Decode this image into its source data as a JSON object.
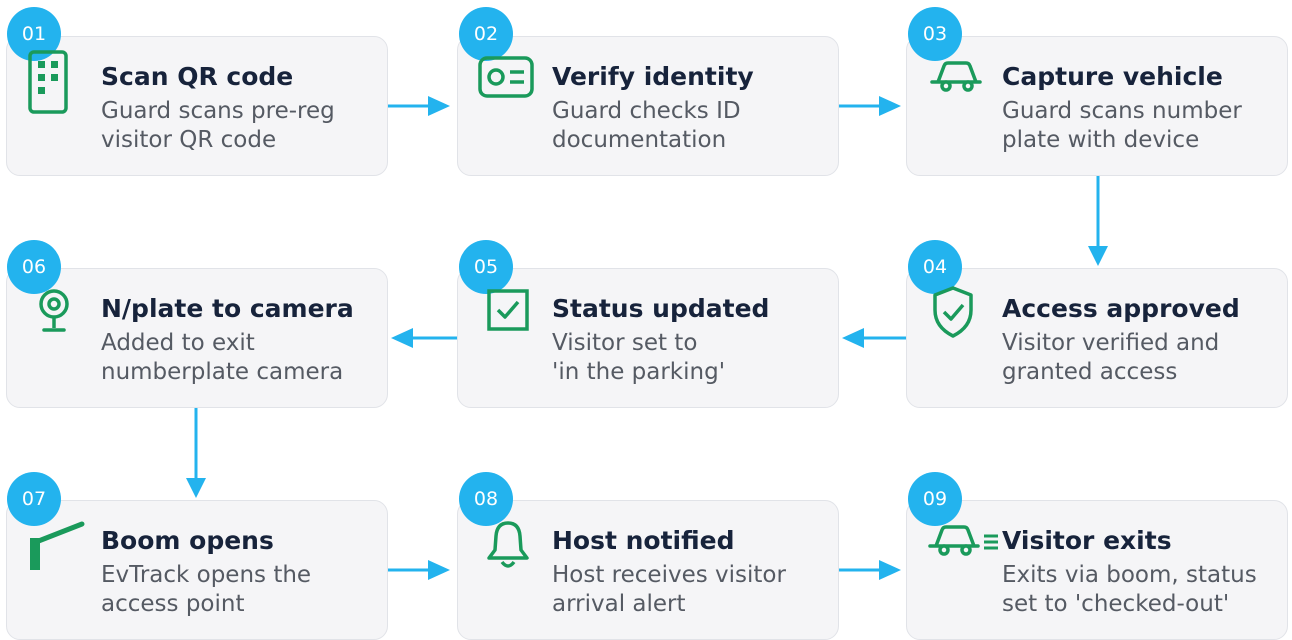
{
  "colors": {
    "accent": "#23b3ee",
    "icon_green": "#1a9a5b",
    "card_bg": "#f5f5f7",
    "card_border": "#e1e3e8",
    "title": "#17233b",
    "text": "#555a63"
  },
  "steps": [
    {
      "num": "01",
      "icon": "qr-code-icon",
      "title": "Scan QR code",
      "desc": [
        "Guard scans pre-reg",
        "visitor QR code"
      ]
    },
    {
      "num": "02",
      "icon": "id-card-icon",
      "title": "Verify identity",
      "desc": [
        "Guard checks ID",
        "documentation"
      ]
    },
    {
      "num": "03",
      "icon": "car-icon",
      "title": "Capture vehicle",
      "desc": [
        "Guard scans number",
        "plate with device"
      ]
    },
    {
      "num": "04",
      "icon": "shield-check-icon",
      "title": "Access approved",
      "desc": [
        "Visitor verified and",
        "granted access"
      ]
    },
    {
      "num": "05",
      "icon": "checkbox-icon",
      "title": "Status updated",
      "desc": [
        "Visitor set to",
        "'in the parking'"
      ]
    },
    {
      "num": "06",
      "icon": "webcam-icon",
      "title": "N/plate to camera",
      "desc": [
        "Added to exit",
        "numberplate camera"
      ]
    },
    {
      "num": "07",
      "icon": "boom-gate-icon",
      "title": "Boom opens",
      "desc": [
        "EvTrack opens the",
        "access point"
      ]
    },
    {
      "num": "08",
      "icon": "bell-icon",
      "title": "Host notified",
      "desc": [
        "Host receives visitor",
        "arrival alert"
      ]
    },
    {
      "num": "09",
      "icon": "car-exit-icon",
      "title": "Visitor exits",
      "desc": [
        "Exits via boom, status",
        "set to 'checked-out'"
      ]
    }
  ]
}
